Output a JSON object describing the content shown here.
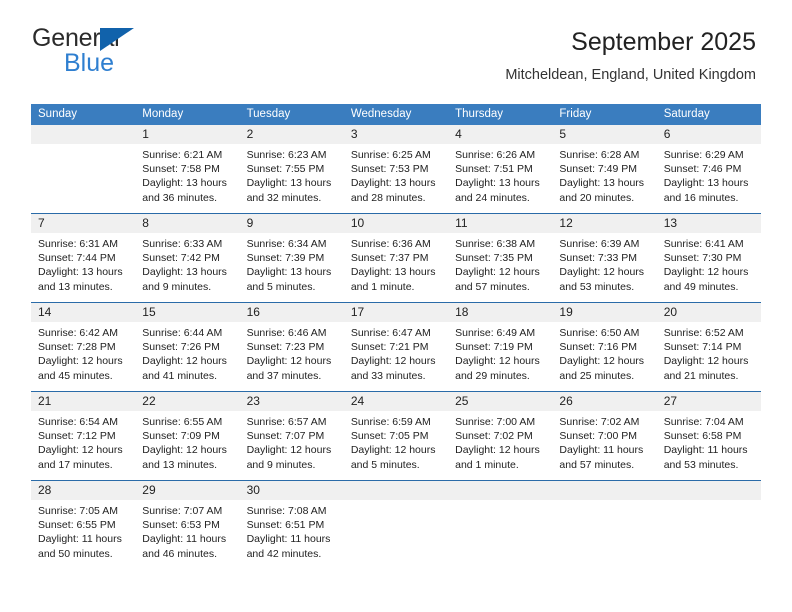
{
  "brand": {
    "name_top": "General",
    "name_bottom": "Blue",
    "triangle_color": "#1162ab",
    "blue_color": "#2f7fd0"
  },
  "header": {
    "title": "September 2025",
    "subtitle": "Mitcheldean, England, United Kingdom"
  },
  "theme": {
    "header_blue": "#3a7dbf",
    "row_border_blue": "#2a6ba8",
    "day_band_gray": "#f0f0f0"
  },
  "weekdays": [
    "Sunday",
    "Monday",
    "Tuesday",
    "Wednesday",
    "Thursday",
    "Friday",
    "Saturday"
  ],
  "weeks": [
    [
      {
        "day": "",
        "lines": []
      },
      {
        "day": "1",
        "lines": [
          "Sunrise: 6:21 AM",
          "Sunset: 7:58 PM",
          "Daylight: 13 hours",
          "and 36 minutes."
        ]
      },
      {
        "day": "2",
        "lines": [
          "Sunrise: 6:23 AM",
          "Sunset: 7:55 PM",
          "Daylight: 13 hours",
          "and 32 minutes."
        ]
      },
      {
        "day": "3",
        "lines": [
          "Sunrise: 6:25 AM",
          "Sunset: 7:53 PM",
          "Daylight: 13 hours",
          "and 28 minutes."
        ]
      },
      {
        "day": "4",
        "lines": [
          "Sunrise: 6:26 AM",
          "Sunset: 7:51 PM",
          "Daylight: 13 hours",
          "and 24 minutes."
        ]
      },
      {
        "day": "5",
        "lines": [
          "Sunrise: 6:28 AM",
          "Sunset: 7:49 PM",
          "Daylight: 13 hours",
          "and 20 minutes."
        ]
      },
      {
        "day": "6",
        "lines": [
          "Sunrise: 6:29 AM",
          "Sunset: 7:46 PM",
          "Daylight: 13 hours",
          "and 16 minutes."
        ]
      }
    ],
    [
      {
        "day": "7",
        "lines": [
          "Sunrise: 6:31 AM",
          "Sunset: 7:44 PM",
          "Daylight: 13 hours",
          "and 13 minutes."
        ]
      },
      {
        "day": "8",
        "lines": [
          "Sunrise: 6:33 AM",
          "Sunset: 7:42 PM",
          "Daylight: 13 hours",
          "and 9 minutes."
        ]
      },
      {
        "day": "9",
        "lines": [
          "Sunrise: 6:34 AM",
          "Sunset: 7:39 PM",
          "Daylight: 13 hours",
          "and 5 minutes."
        ]
      },
      {
        "day": "10",
        "lines": [
          "Sunrise: 6:36 AM",
          "Sunset: 7:37 PM",
          "Daylight: 13 hours",
          "and 1 minute."
        ]
      },
      {
        "day": "11",
        "lines": [
          "Sunrise: 6:38 AM",
          "Sunset: 7:35 PM",
          "Daylight: 12 hours",
          "and 57 minutes."
        ]
      },
      {
        "day": "12",
        "lines": [
          "Sunrise: 6:39 AM",
          "Sunset: 7:33 PM",
          "Daylight: 12 hours",
          "and 53 minutes."
        ]
      },
      {
        "day": "13",
        "lines": [
          "Sunrise: 6:41 AM",
          "Sunset: 7:30 PM",
          "Daylight: 12 hours",
          "and 49 minutes."
        ]
      }
    ],
    [
      {
        "day": "14",
        "lines": [
          "Sunrise: 6:42 AM",
          "Sunset: 7:28 PM",
          "Daylight: 12 hours",
          "and 45 minutes."
        ]
      },
      {
        "day": "15",
        "lines": [
          "Sunrise: 6:44 AM",
          "Sunset: 7:26 PM",
          "Daylight: 12 hours",
          "and 41 minutes."
        ]
      },
      {
        "day": "16",
        "lines": [
          "Sunrise: 6:46 AM",
          "Sunset: 7:23 PM",
          "Daylight: 12 hours",
          "and 37 minutes."
        ]
      },
      {
        "day": "17",
        "lines": [
          "Sunrise: 6:47 AM",
          "Sunset: 7:21 PM",
          "Daylight: 12 hours",
          "and 33 minutes."
        ]
      },
      {
        "day": "18",
        "lines": [
          "Sunrise: 6:49 AM",
          "Sunset: 7:19 PM",
          "Daylight: 12 hours",
          "and 29 minutes."
        ]
      },
      {
        "day": "19",
        "lines": [
          "Sunrise: 6:50 AM",
          "Sunset: 7:16 PM",
          "Daylight: 12 hours",
          "and 25 minutes."
        ]
      },
      {
        "day": "20",
        "lines": [
          "Sunrise: 6:52 AM",
          "Sunset: 7:14 PM",
          "Daylight: 12 hours",
          "and 21 minutes."
        ]
      }
    ],
    [
      {
        "day": "21",
        "lines": [
          "Sunrise: 6:54 AM",
          "Sunset: 7:12 PM",
          "Daylight: 12 hours",
          "and 17 minutes."
        ]
      },
      {
        "day": "22",
        "lines": [
          "Sunrise: 6:55 AM",
          "Sunset: 7:09 PM",
          "Daylight: 12 hours",
          "and 13 minutes."
        ]
      },
      {
        "day": "23",
        "lines": [
          "Sunrise: 6:57 AM",
          "Sunset: 7:07 PM",
          "Daylight: 12 hours",
          "and 9 minutes."
        ]
      },
      {
        "day": "24",
        "lines": [
          "Sunrise: 6:59 AM",
          "Sunset: 7:05 PM",
          "Daylight: 12 hours",
          "and 5 minutes."
        ]
      },
      {
        "day": "25",
        "lines": [
          "Sunrise: 7:00 AM",
          "Sunset: 7:02 PM",
          "Daylight: 12 hours",
          "and 1 minute."
        ]
      },
      {
        "day": "26",
        "lines": [
          "Sunrise: 7:02 AM",
          "Sunset: 7:00 PM",
          "Daylight: 11 hours",
          "and 57 minutes."
        ]
      },
      {
        "day": "27",
        "lines": [
          "Sunrise: 7:04 AM",
          "Sunset: 6:58 PM",
          "Daylight: 11 hours",
          "and 53 minutes."
        ]
      }
    ],
    [
      {
        "day": "28",
        "lines": [
          "Sunrise: 7:05 AM",
          "Sunset: 6:55 PM",
          "Daylight: 11 hours",
          "and 50 minutes."
        ]
      },
      {
        "day": "29",
        "lines": [
          "Sunrise: 7:07 AM",
          "Sunset: 6:53 PM",
          "Daylight: 11 hours",
          "and 46 minutes."
        ]
      },
      {
        "day": "30",
        "lines": [
          "Sunrise: 7:08 AM",
          "Sunset: 6:51 PM",
          "Daylight: 11 hours",
          "and 42 minutes."
        ]
      },
      {
        "day": "",
        "lines": []
      },
      {
        "day": "",
        "lines": []
      },
      {
        "day": "",
        "lines": []
      },
      {
        "day": "",
        "lines": []
      }
    ]
  ]
}
